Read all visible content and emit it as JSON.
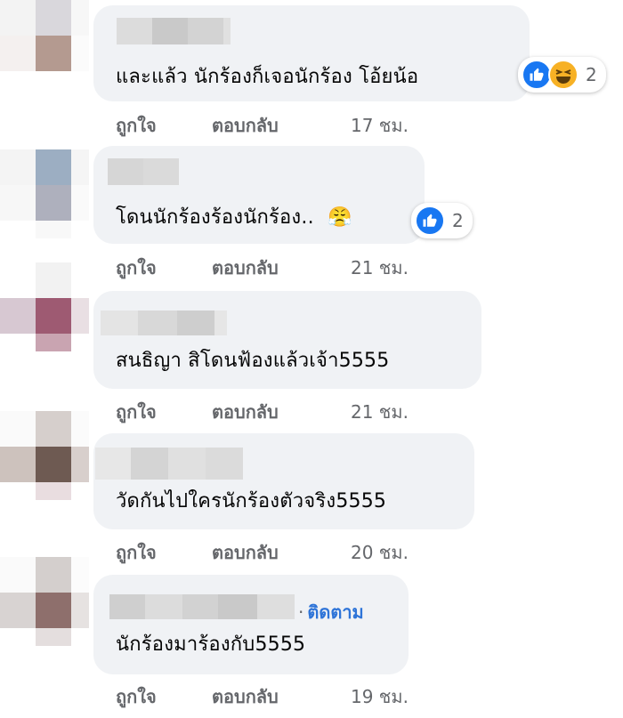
{
  "comments": [
    {
      "text": "และแล้ว นักร้องก็เจอนักร้อง โอ้ยน้อ",
      "actions": {
        "like": "ถูกใจ",
        "reply": "ตอบกลับ",
        "time": "17 ชม."
      },
      "reactions": {
        "icons": [
          "like-icon",
          "haha-icon"
        ],
        "count": "2"
      }
    },
    {
      "text": "โดนนักร้องร้องนักร้อง..",
      "emoji": "😤",
      "actions": {
        "like": "ถูกใจ",
        "reply": "ตอบกลับ",
        "time": "21 ชม."
      },
      "reactions": {
        "icons": [
          "like-icon"
        ],
        "count": "2"
      }
    },
    {
      "text": "สนธิญา สิโดนฟ้องแล้วเจ้า5555",
      "actions": {
        "like": "ถูกใจ",
        "reply": "ตอบกลับ",
        "time": "21 ชม."
      }
    },
    {
      "text": "วัดกันไปใครนักร้องตัวจริง5555",
      "actions": {
        "like": "ถูกใจ",
        "reply": "ตอบกลับ",
        "time": "20 ชม."
      }
    },
    {
      "text": "นักร้องมาร้องกับ5555",
      "follow_label": "ติดตาม",
      "follow_dot": "·",
      "actions": {
        "like": "ถูกใจ",
        "reply": "ตอบกลับ",
        "time": "19 ชม."
      }
    }
  ],
  "colors": {
    "like": "#1877f2",
    "haha": "#f7b125",
    "follow": "#2e74d8",
    "meta": "#65676b",
    "bubble": "#f0f2f5"
  }
}
